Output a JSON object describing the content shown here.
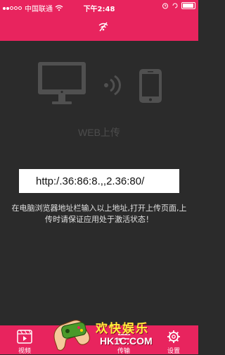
{
  "status_bar": {
    "carrier": "中国联通",
    "time": "下午2:48"
  },
  "header": {
    "icon": "wifi-off-icon"
  },
  "main": {
    "web_title": "WEB上传",
    "url": "http:/.36:86:8.,,2.36:80/",
    "hint": "在电脑浏览器地址栏输入以上地址,打开上传页面,上传时请保证应用处于激活状态！",
    "devices": [
      "monitor-icon",
      "wireless-waves-icon",
      "phone-icon"
    ]
  },
  "tabbar": {
    "items": [
      {
        "label": "视频",
        "icon": "video-icon"
      },
      {
        "label": "传输",
        "icon": "transfer-icon"
      },
      {
        "label": "设置",
        "icon": "gear-icon"
      }
    ]
  },
  "watermark": {
    "title": "欢快娱乐",
    "domain": "HK1C.COM"
  },
  "colors": {
    "accent": "#e8245e",
    "background": "#2b2b2b",
    "device_gray": "#505050"
  }
}
